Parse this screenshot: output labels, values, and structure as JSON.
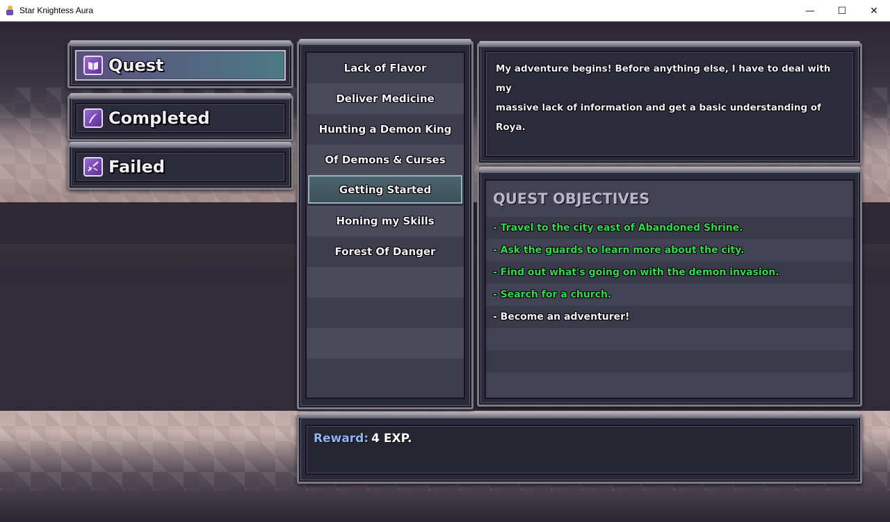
{
  "window": {
    "title": "Star Knightess Aura",
    "minimize_glyph": "—",
    "maximize_glyph": "☐",
    "close_glyph": "✕"
  },
  "categories": [
    {
      "label": "Quest",
      "icon": "book-icon",
      "active": true
    },
    {
      "label": "Completed",
      "icon": "quill-icon",
      "active": false
    },
    {
      "label": "Failed",
      "icon": "broken-sword-icon",
      "active": false
    }
  ],
  "quests": [
    {
      "label": "Lack of Flavor"
    },
    {
      "label": "Deliver Medicine"
    },
    {
      "label": "Hunting a Demon King"
    },
    {
      "label": "Of Demons & Curses"
    },
    {
      "label": "Getting Started",
      "selected": true
    },
    {
      "label": "Honing my Skills"
    },
    {
      "label": "Forest Of Danger"
    }
  ],
  "description": {
    "line1": "My adventure begins! Before anything else, I have to deal with my",
    "line2": "massive lack of information and get a basic understanding of Roya."
  },
  "objectives": {
    "title": "QUEST OBJECTIVES",
    "items": [
      {
        "text": "- Travel to the city east of Abandoned Shrine.",
        "done": true
      },
      {
        "text": "- Ask the guards to learn more about the city.",
        "done": true
      },
      {
        "text": "- Find out what's going on with the demon invasion.",
        "done": true
      },
      {
        "text": "- Search for a church.",
        "done": true
      },
      {
        "text": "- Become an adventurer!",
        "done": false
      }
    ]
  },
  "reward": {
    "label": "Reward:",
    "value": "4 EXP."
  },
  "colors": {
    "done": "#34d94e",
    "todo": "#f4f2f8",
    "reward_label": "#8fb4ef",
    "active_tab": "#4c7a84"
  }
}
